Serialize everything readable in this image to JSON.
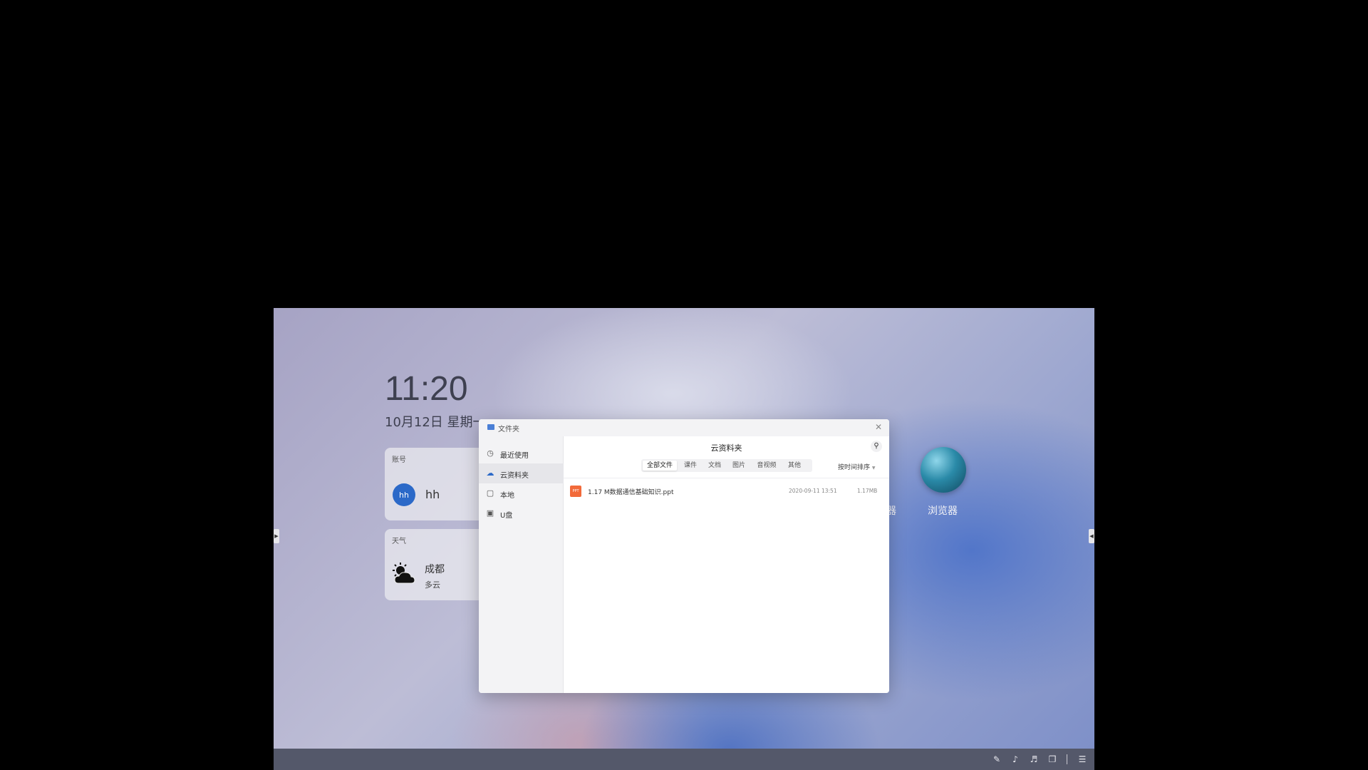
{
  "desktop": {
    "clock": "11:20",
    "date": "10月12日 星期一",
    "account_widget": {
      "heading": "账号",
      "avatar_text": "hh",
      "name": "hh"
    },
    "weather_widget": {
      "heading": "天气",
      "city": "成都",
      "condition": "多云"
    },
    "apps": {
      "partial_label": "器",
      "browser_label": "浏览器"
    }
  },
  "dialog": {
    "window_title": "文件夹",
    "sidebar": [
      {
        "label": "最近使用",
        "icon": "clock-icon"
      },
      {
        "label": "云资料夹",
        "icon": "cloud-icon",
        "active": true
      },
      {
        "label": "本地",
        "icon": "book-icon"
      },
      {
        "label": "U盘",
        "icon": "usb-icon"
      }
    ],
    "main_title": "云资料夹",
    "tabs": [
      "全部文件",
      "课件",
      "文档",
      "图片",
      "音视频",
      "其他"
    ],
    "active_tab": "全部文件",
    "sort_label": "按时间排序",
    "files": [
      {
        "type_badge": "PPT",
        "name": "1.17 M数据通信基础知识.ppt",
        "date": "2020-09-11 13:51",
        "size": "1.17MB"
      }
    ]
  },
  "colors": {
    "accent": "#2b69c8",
    "ppt": "#f26a3a",
    "taskbar": "#54586a"
  }
}
